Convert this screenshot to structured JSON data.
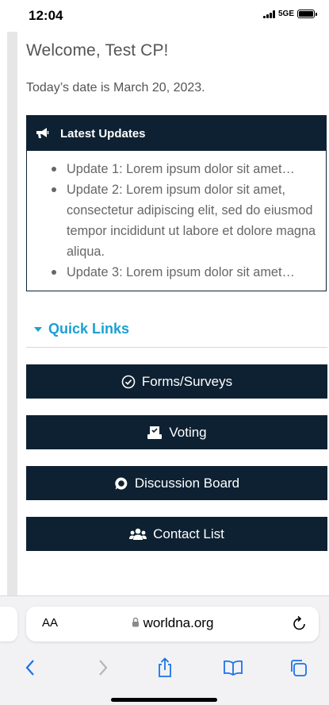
{
  "status_bar": {
    "time": "12:04",
    "network": "5GE"
  },
  "page": {
    "welcome": "Welcome, Test CP!",
    "date_text": "Today’s date is March 20, 2023."
  },
  "updates": {
    "title": "Latest Updates",
    "icon": "megaphone-icon",
    "items": [
      "Update 1: Lorem ipsum dolor sit amet…",
      "Update 2:  Lorem ipsum dolor sit amet, consectetur adipiscing elit, sed do eiusmod tempor incididunt ut labore et dolore magna aliqua.",
      "Update 3: Lorem ipsum dolor sit amet…"
    ]
  },
  "quick_links": {
    "title": "Quick Links",
    "buttons": [
      {
        "label": "Forms/Surveys",
        "icon": "check-circle-icon"
      },
      {
        "label": "Voting",
        "icon": "ballot-box-icon"
      },
      {
        "label": "Discussion Board",
        "icon": "chat-bubble-icon"
      },
      {
        "label": "Contact List",
        "icon": "users-icon"
      }
    ]
  },
  "browser": {
    "text_size_label": "AA",
    "url": "worldna.org"
  },
  "colors": {
    "navy": "#0e2132",
    "accent": "#1aa0d4"
  }
}
